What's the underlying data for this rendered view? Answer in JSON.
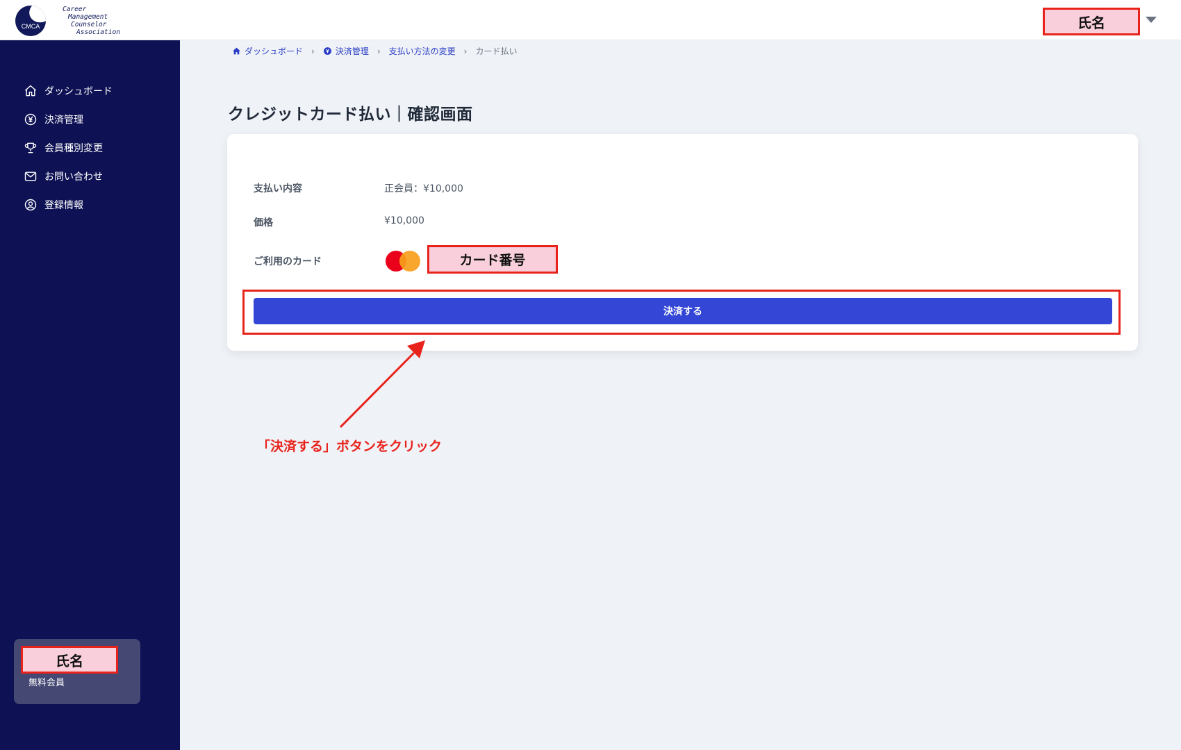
{
  "header": {
    "logo": {
      "abbr": "CMCA",
      "lines": [
        "Career",
        "Management",
        "Counselor",
        "Association"
      ]
    },
    "user_name": "氏名"
  },
  "sidebar": {
    "items": [
      {
        "label": "ダッシュボード",
        "icon": "home-icon"
      },
      {
        "label": "決済管理",
        "icon": "yen-icon"
      },
      {
        "label": "会員種別変更",
        "icon": "trophy-icon"
      },
      {
        "label": "お問い合わせ",
        "icon": "mail-icon"
      },
      {
        "label": "登録情報",
        "icon": "user-circle-icon"
      }
    ],
    "user": {
      "name": "氏名",
      "tier": "無料会員"
    }
  },
  "breadcrumb": {
    "items": [
      "ダッシュボード",
      "決済管理",
      "支払い方法の変更"
    ],
    "current": "カード払い"
  },
  "page": {
    "title": "クレジットカード払い｜確認画面"
  },
  "details": {
    "rows": [
      {
        "label": "支払い内容",
        "value": "正会員：¥10,000"
      },
      {
        "label": "価格",
        "value": "¥10,000"
      },
      {
        "label": "ご利用のカード",
        "value": "カード番号"
      }
    ],
    "pay_button": "決済する"
  },
  "annotation": {
    "text": "「決済する」ボタンをクリック",
    "color": "#e8231b"
  },
  "colors": {
    "sidebar_bg": "#0e1254",
    "primary": "#3446d6",
    "highlight": "#e8231b",
    "redaction": "#f8cfdb"
  }
}
